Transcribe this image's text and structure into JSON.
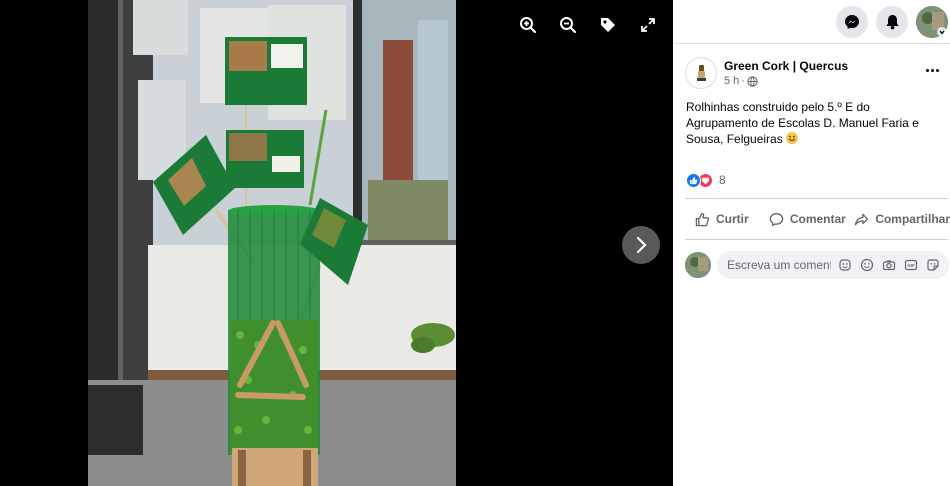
{
  "viewer": {
    "tools": [
      {
        "name": "zoom-in-icon"
      },
      {
        "name": "zoom-out-icon"
      },
      {
        "name": "tag-icon"
      },
      {
        "name": "fullscreen-icon"
      }
    ],
    "next_icon": "chevron-right-icon"
  },
  "topbar": {
    "messenger_icon": "messenger-icon",
    "notifications_icon": "bell-icon",
    "account_icon": "avatar"
  },
  "post": {
    "page_name": "Green Cork | Quercus",
    "time": "5 h",
    "separator": "·",
    "audience_icon": "globe-icon",
    "text": "Rolhinhas construido pelo 5.º E do Agrupamento de Escolas D. Manuel Faria e Sousa, Felgueiras",
    "reaction_count": "8",
    "actions": {
      "like": "Curtir",
      "comment": "Comentar",
      "share": "Compartilhar"
    },
    "comment_placeholder": "Escreva um comentário..."
  },
  "colors": {
    "accent": "#1877f2",
    "love": "#f33e58",
    "secondary_text": "#65676b"
  }
}
